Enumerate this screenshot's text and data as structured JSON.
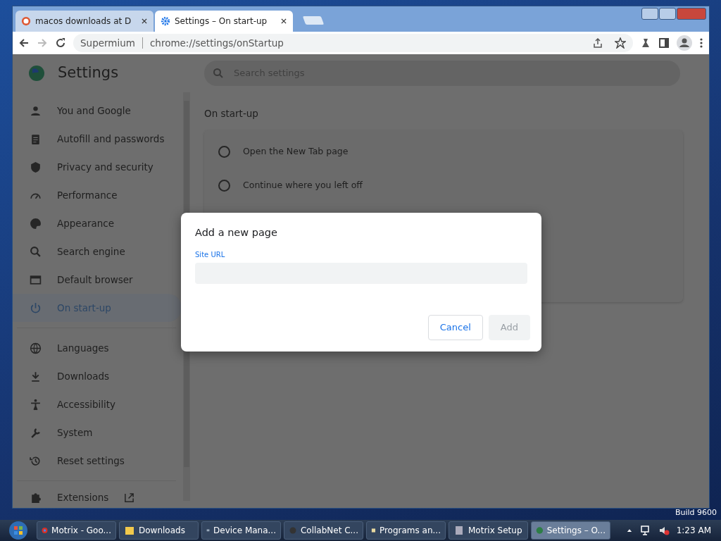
{
  "browser": {
    "tabs": [
      {
        "title": "macos downloads at D",
        "selected": false
      },
      {
        "title": "Settings – On start-up",
        "selected": true
      }
    ],
    "omnibox": {
      "site": "Supermium",
      "url": "chrome://settings/onStartup"
    }
  },
  "settings": {
    "title": "Settings",
    "search": {
      "placeholder": "Search settings"
    },
    "sidebar": {
      "items": [
        {
          "label": "You and Google",
          "selected": false
        },
        {
          "label": "Autofill and passwords",
          "selected": false
        },
        {
          "label": "Privacy and security",
          "selected": false
        },
        {
          "label": "Performance",
          "selected": false
        },
        {
          "label": "Appearance",
          "selected": false
        },
        {
          "label": "Search engine",
          "selected": false
        },
        {
          "label": "Default browser",
          "selected": false
        },
        {
          "label": "On start-up",
          "selected": true
        },
        {
          "label": "Languages",
          "selected": false
        },
        {
          "label": "Downloads",
          "selected": false
        },
        {
          "label": "Accessibility",
          "selected": false
        },
        {
          "label": "System",
          "selected": false
        },
        {
          "label": "Reset settings",
          "selected": false
        },
        {
          "label": "Extensions",
          "selected": false
        }
      ]
    },
    "section_title": "On start-up",
    "options": [
      {
        "label": "Open the New Tab page",
        "checked": false
      },
      {
        "label": "Continue where you left off",
        "checked": false
      }
    ]
  },
  "dialog": {
    "title": "Add a new page",
    "field_label": "Site URL",
    "buttons": [
      {
        "label": "Cancel",
        "disabled": false
      },
      {
        "label": "Add",
        "disabled": true
      }
    ]
  },
  "desktop": {
    "watermark_text": "Build 9600"
  },
  "taskbar": {
    "items": [
      {
        "label": "Motrix - Goo...",
        "selected": false
      },
      {
        "label": "Downloads",
        "selected": false
      },
      {
        "label": "Device Mana...",
        "selected": false
      },
      {
        "label": "CollabNet C...",
        "selected": false
      },
      {
        "label": "Programs an...",
        "selected": false
      },
      {
        "label": "Motrix Setup",
        "selected": false
      },
      {
        "label": "Settings – O...",
        "selected": true
      }
    ],
    "clock": "1:23 AM"
  }
}
